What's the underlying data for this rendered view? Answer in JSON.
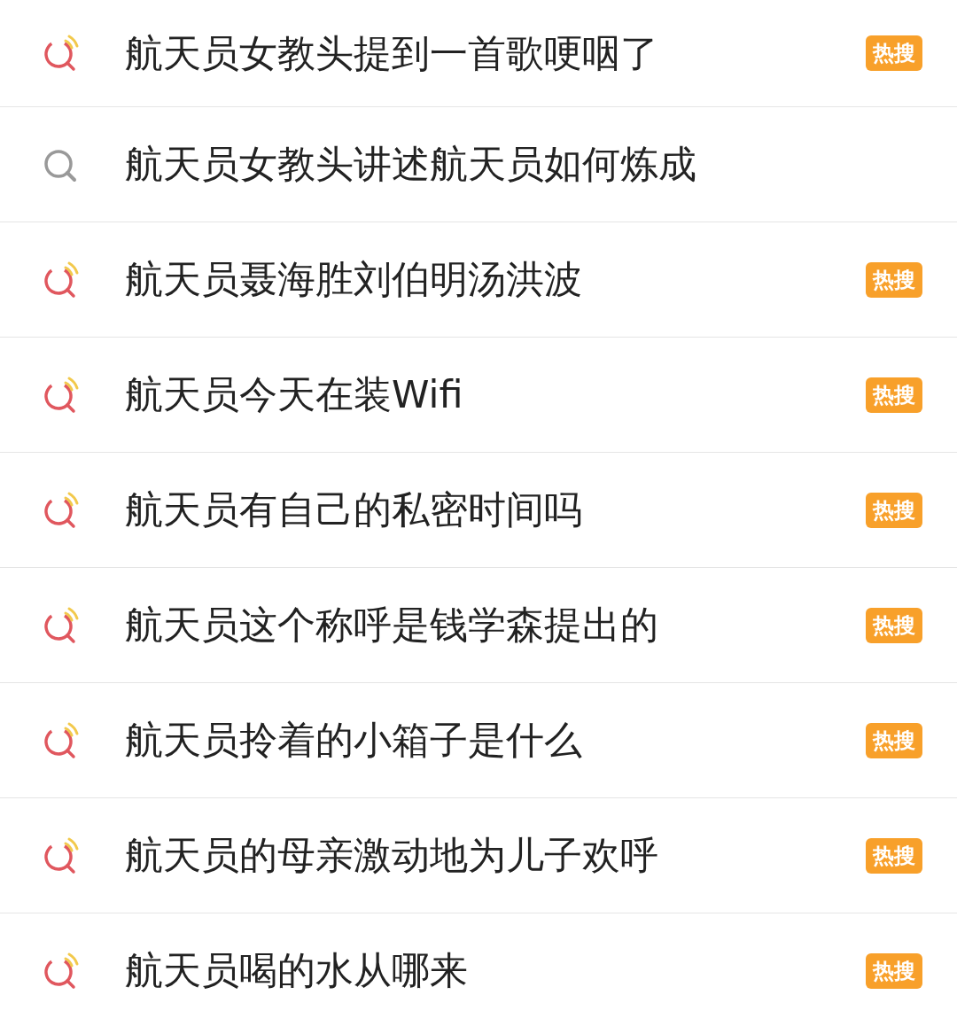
{
  "suggestions": [
    {
      "kind": "hot",
      "text": "航天员女教头提到一首歌哽咽了",
      "badge": "热搜"
    },
    {
      "kind": "plain",
      "text": "航天员女教头讲述航天员如何炼成"
    },
    {
      "kind": "hot",
      "text": "航天员聂海胜刘伯明汤洪波",
      "badge": "热搜"
    },
    {
      "kind": "hot",
      "text": "航天员今天在装Wifi",
      "badge": "热搜"
    },
    {
      "kind": "hot",
      "text": "航天员有自己的私密时间吗",
      "badge": "热搜"
    },
    {
      "kind": "hot",
      "text": "航天员这个称呼是钱学森提出的",
      "badge": "热搜"
    },
    {
      "kind": "hot",
      "text": "航天员拎着的小箱子是什么",
      "badge": "热搜"
    },
    {
      "kind": "hot",
      "text": "航天员的母亲激动地为儿子欢呼",
      "badge": "热搜"
    },
    {
      "kind": "hot",
      "text": "航天员喝的水从哪来",
      "badge": "热搜"
    }
  ]
}
